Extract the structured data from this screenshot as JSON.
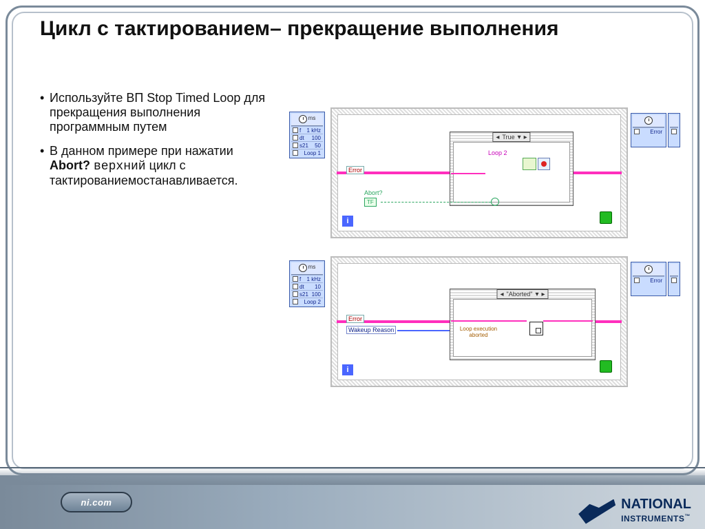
{
  "slide": {
    "title": "Цикл с тактированием– прекращение выполнения"
  },
  "bullets": [
    "Используйте ВП Stop Timed Loop для прекращения выполнения программным путем",
    "В данном примере при нажатии "
  ],
  "bullet2_bold": "Abort?",
  "bullet2_mono": " верхний",
  "bullet2_rest": " цикл с тактированиемостанавливается.",
  "diagram1": {
    "ms": "ms",
    "left": [
      {
        "pin": "f",
        "val": "1 kHz"
      },
      {
        "pin": "dt",
        "val": "100"
      },
      {
        "pin": "s21",
        "val": "50"
      },
      {
        "pin": "name",
        "val": "Loop 1"
      }
    ],
    "right": {
      "err": "Error"
    },
    "errorLabel": "Error",
    "case": {
      "label": "True",
      "loopName": "Loop 2"
    },
    "abortLabel": "Abort?",
    "tf": "TF",
    "iTerm": "i"
  },
  "diagram2": {
    "ms": "ms",
    "left": [
      {
        "pin": "f",
        "val": "1 kHz"
      },
      {
        "pin": "dt",
        "val": "10"
      },
      {
        "pin": "s21",
        "val": "100"
      },
      {
        "pin": "name",
        "val": "Loop 2"
      }
    ],
    "right": {
      "err": "Error"
    },
    "errorLabel": "Error",
    "wakeupLabel": "Wakeup Reason",
    "case": {
      "label": "\"Aborted\"",
      "msg": "Loop execution aborted"
    },
    "iTerm": "i"
  },
  "footer": {
    "pill": "ni.com",
    "brand_top": "NATIONAL",
    "brand_bottom": "INSTRUMENTS",
    "tm": "™"
  }
}
